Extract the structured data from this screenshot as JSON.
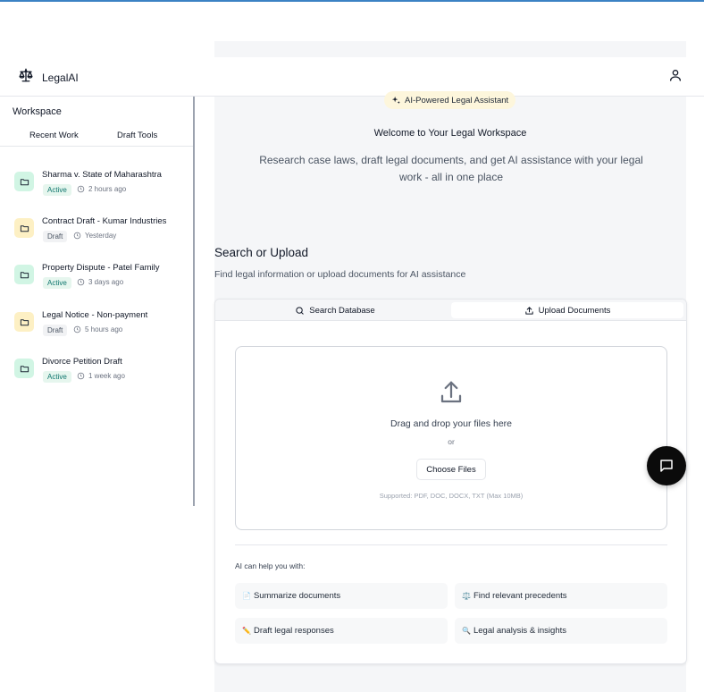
{
  "app": {
    "name": "LegalAI"
  },
  "sidebar": {
    "title": "Workspace",
    "tabs": [
      "Recent Work",
      "Draft Tools"
    ],
    "items": [
      {
        "title": "Sharma v. State of Maharashtra",
        "status": "Active",
        "time": "2 hours ago",
        "color": "#d1f5e4"
      },
      {
        "title": "Contract Draft - Kumar Industries",
        "status": "Draft",
        "time": "Yesterday",
        "color": "#fdf0c4"
      },
      {
        "title": "Property Dispute - Patel Family",
        "status": "Active",
        "time": "3 days ago",
        "color": "#d1f5e4"
      },
      {
        "title": "Legal Notice - Non-payment",
        "status": "Draft",
        "time": "5 hours ago",
        "color": "#fdf0c4"
      },
      {
        "title": "Divorce Petition Draft",
        "status": "Active",
        "time": "1 week ago",
        "color": "#d1f5e4"
      }
    ]
  },
  "hero": {
    "badge": "AI-Powered Legal Assistant",
    "welcome": "Welcome to Your Legal Workspace",
    "subtitle": "Research case laws, draft legal documents, and get AI assistance with your legal work - all in one place"
  },
  "section": {
    "title": "Search or Upload",
    "subtitle": "Find legal information or upload documents for AI assistance"
  },
  "tabs": {
    "search": "Search Database",
    "upload": "Upload Documents",
    "selected": "Upload Documents"
  },
  "upload": {
    "drag_text": "Drag and drop your files here",
    "or": "or",
    "choose_button": "Choose Files",
    "supported": "Supported: PDF, DOC, DOCX, TXT (Max 10MB)"
  },
  "help": {
    "title": "AI can help you with:",
    "features": [
      {
        "emoji": "📄",
        "label": "Summarize documents"
      },
      {
        "emoji": "⚖️",
        "label": "Find relevant precedents"
      },
      {
        "emoji": "✏️",
        "label": "Draft legal responses"
      },
      {
        "emoji": "🔍",
        "label": "Legal analysis & insights"
      }
    ]
  }
}
